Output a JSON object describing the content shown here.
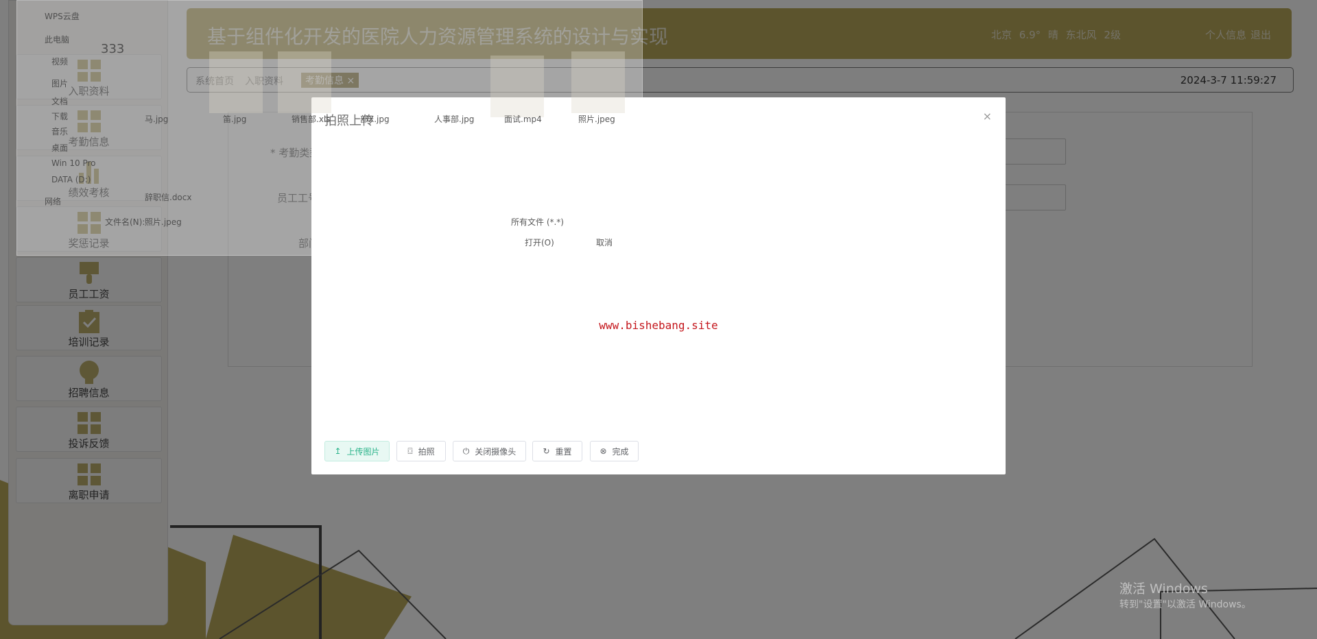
{
  "header": {
    "title": "基于组件化开发的医院人力资源管理系统的设计与实现",
    "weather": "北京 6.9° 晴 东北风 2级",
    "profile_link": "个人信息",
    "logout_link": "退出"
  },
  "breadcrumb": {
    "items": [
      "系统首页",
      "入职资料"
    ],
    "active_tab": "考勤信息 ×",
    "datetime": "2024-3-7 11:59:27"
  },
  "sidebar": {
    "items": [
      {
        "label": "入职资料",
        "icon": "grid-icon"
      },
      {
        "label": "考勤信息",
        "icon": "grid-icon"
      },
      {
        "label": "绩效考核",
        "icon": "bar-chart-icon"
      },
      {
        "label": "奖惩记录",
        "icon": "grid-icon"
      },
      {
        "label": "员工工资",
        "icon": "brush-icon"
      },
      {
        "label": "培训记录",
        "icon": "clipboard-check-icon"
      },
      {
        "label": "招聘信息",
        "icon": "lightbulb-icon"
      },
      {
        "label": "投诉反馈",
        "icon": "grid-icon"
      },
      {
        "label": "离职申请",
        "icon": "grid-icon"
      }
    ]
  },
  "form": {
    "fields": [
      {
        "label": "* 考勤类型"
      },
      {
        "label": "员工工号"
      },
      {
        "label": "部门"
      }
    ]
  },
  "file_dialog": {
    "sidebar": [
      "WPS云盘",
      "此电脑",
      "视频",
      "图片",
      "文档",
      "下载",
      "音乐",
      "桌面",
      "Win 10 Pro",
      "DATA (D:)",
      "网络"
    ],
    "user": "333",
    "files": [
      "马.jpg",
      "笛.jpg",
      "销售部.xls",
      "部X.jpg",
      "人事部.jpg",
      "面试.mp4",
      "照片.jpeg",
      "辞职信.docx"
    ],
    "filename_label": "文件名(N):",
    "filename_value": "照片.jpeg",
    "filter": "所有文件 (*.*)",
    "open_button": "打开(O)",
    "cancel_button": "取消"
  },
  "dialog": {
    "title": "拍照上传",
    "close": "×",
    "watermark": "www.bishebang.site",
    "buttons": [
      {
        "label": "上传图片",
        "icon": "upload-icon"
      },
      {
        "label": "拍照",
        "icon": "camera-icon"
      },
      {
        "label": "关闭摄像头",
        "icon": "power-icon"
      },
      {
        "label": "重置",
        "icon": "refresh-icon"
      },
      {
        "label": "完成",
        "icon": "check-circle-icon"
      }
    ]
  },
  "windows_activation": {
    "title": "激活 Windows",
    "subtitle": "转到\"设置\"以激活 Windows。"
  },
  "colors": {
    "accent": "#2bb38a",
    "header": "#b9a95a",
    "watermark": "#c4161c"
  }
}
